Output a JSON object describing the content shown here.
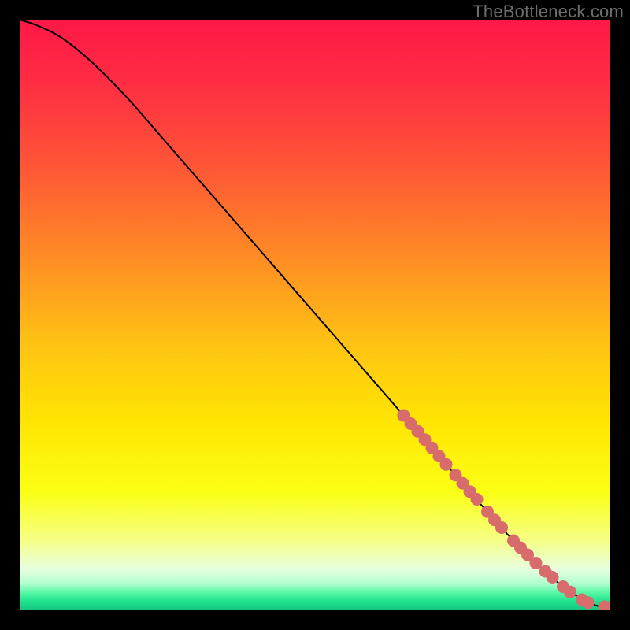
{
  "watermark": "TheBottleneck.com",
  "colors": {
    "curve": "#000000",
    "marker_fill": "#d86b6b",
    "marker_stroke": "#8c3a3a",
    "gradient_stops": [
      {
        "offset": 0.0,
        "color": "#ff1846"
      },
      {
        "offset": 0.1,
        "color": "#ff2b44"
      },
      {
        "offset": 0.25,
        "color": "#ff5636"
      },
      {
        "offset": 0.4,
        "color": "#ff8b25"
      },
      {
        "offset": 0.55,
        "color": "#ffc313"
      },
      {
        "offset": 0.68,
        "color": "#ffe502"
      },
      {
        "offset": 0.8,
        "color": "#fbff14"
      },
      {
        "offset": 0.88,
        "color": "#f6ff84"
      },
      {
        "offset": 0.93,
        "color": "#e7ffde"
      },
      {
        "offset": 0.955,
        "color": "#b0ffcf"
      },
      {
        "offset": 0.97,
        "color": "#57f7a6"
      },
      {
        "offset": 0.985,
        "color": "#1fe28f"
      },
      {
        "offset": 1.0,
        "color": "#14c67f"
      }
    ]
  },
  "chart_data": {
    "type": "line",
    "title": "",
    "xlabel": "",
    "ylabel": "",
    "xlim": [
      0,
      100
    ],
    "ylim": [
      0,
      100
    ],
    "series": [
      {
        "name": "curve",
        "x": [
          0,
          3,
          7,
          12,
          18,
          25,
          35,
          45,
          55,
          65,
          75,
          82,
          88,
          92,
          95,
          97,
          98.5,
          100
        ],
        "y": [
          100,
          99,
          97,
          93,
          87,
          79,
          67.5,
          56,
          44.5,
          33,
          21.5,
          13.5,
          7.5,
          4,
          2,
          1,
          0.6,
          0.5
        ]
      }
    ],
    "markers": {
      "name": "highlighted-points",
      "points": [
        {
          "x": 65.0,
          "y": 33.0
        },
        {
          "x": 66.2,
          "y": 31.6
        },
        {
          "x": 67.4,
          "y": 30.3
        },
        {
          "x": 68.6,
          "y": 28.9
        },
        {
          "x": 69.8,
          "y": 27.5
        },
        {
          "x": 71.0,
          "y": 26.1
        },
        {
          "x": 72.2,
          "y": 24.7
        },
        {
          "x": 73.8,
          "y": 22.9
        },
        {
          "x": 75.0,
          "y": 21.5
        },
        {
          "x": 76.2,
          "y": 20.1
        },
        {
          "x": 77.4,
          "y": 18.8
        },
        {
          "x": 79.2,
          "y": 16.7
        },
        {
          "x": 80.4,
          "y": 15.3
        },
        {
          "x": 81.6,
          "y": 14.0
        },
        {
          "x": 83.6,
          "y": 11.8
        },
        {
          "x": 84.8,
          "y": 10.6
        },
        {
          "x": 86.0,
          "y": 9.4
        },
        {
          "x": 87.4,
          "y": 8.0
        },
        {
          "x": 89.0,
          "y": 6.6
        },
        {
          "x": 90.2,
          "y": 5.6
        },
        {
          "x": 92.0,
          "y": 4.0
        },
        {
          "x": 93.2,
          "y": 3.1
        },
        {
          "x": 95.2,
          "y": 1.8
        },
        {
          "x": 96.2,
          "y": 1.3
        },
        {
          "x": 99.0,
          "y": 0.6
        },
        {
          "x": 100.0,
          "y": 0.5
        }
      ]
    }
  }
}
